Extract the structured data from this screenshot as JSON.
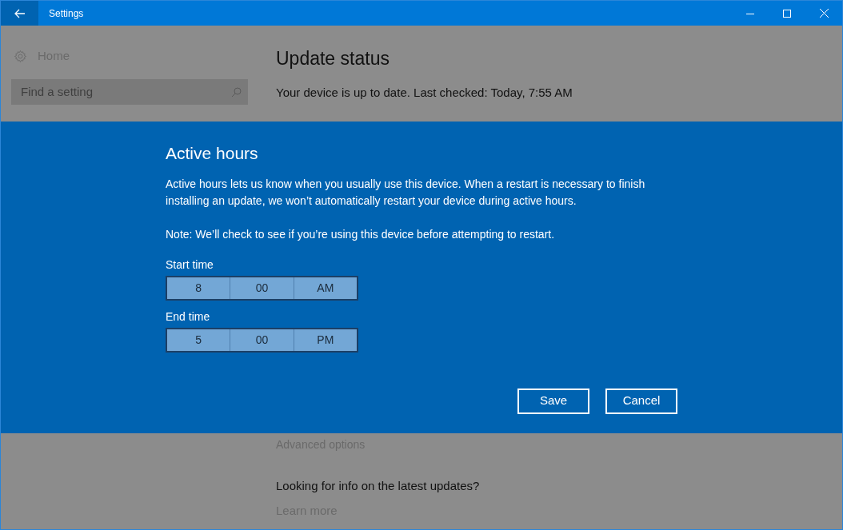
{
  "window": {
    "title": "Settings"
  },
  "sidebar": {
    "home": "Home",
    "search": {
      "placeholder": "Find a setting"
    }
  },
  "main": {
    "heading": "Update status",
    "status": "Your device is up to date. Last checked: Today, 7:55 AM",
    "advanced_link": "Advanced options",
    "info_heading": "Looking for info on the latest updates?",
    "learn_more": "Learn more"
  },
  "dialog": {
    "title": "Active hours",
    "description": "Active hours lets us know when you usually use this device. When a restart is necessary to finish installing an update, we won’t automatically restart your device during active hours.",
    "note": "Note: We’ll check to see if you’re using this device before attempting to restart.",
    "times": [
      {
        "label": "Start time",
        "hour": "8",
        "minute": "00",
        "period": "AM"
      },
      {
        "label": "End time",
        "hour": "5",
        "minute": "00",
        "period": "PM"
      }
    ],
    "buttons": [
      "Save",
      "Cancel"
    ]
  }
}
